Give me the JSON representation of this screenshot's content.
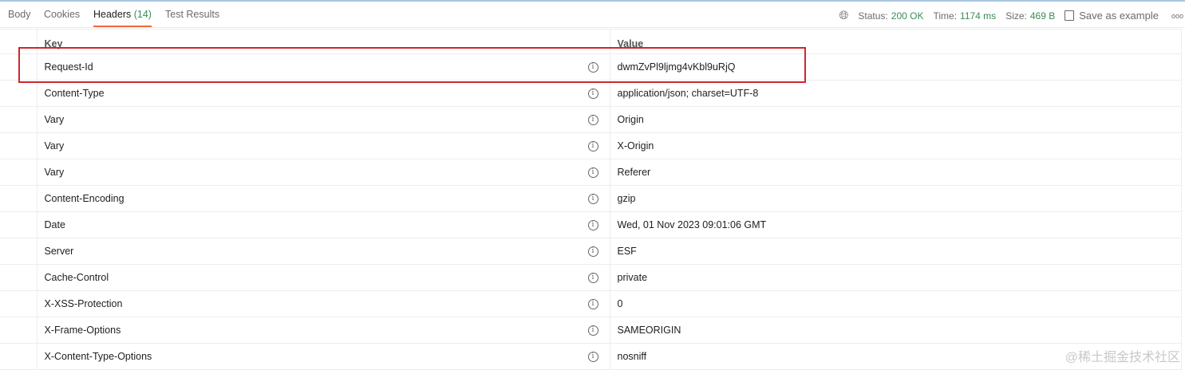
{
  "tabs": [
    {
      "label": "Body"
    },
    {
      "label": "Cookies"
    },
    {
      "label": "Headers",
      "count": "(14)"
    },
    {
      "label": "Test Results"
    }
  ],
  "status": {
    "status_label": "Status:",
    "status_value": "200 OK",
    "time_label": "Time:",
    "time_value": "1174 ms",
    "size_label": "Size:",
    "size_value": "469 B",
    "save_label": "Save as example",
    "more": "ooo"
  },
  "columns": {
    "key": "Key",
    "value": "Value"
  },
  "rows": [
    {
      "key": "Request-Id",
      "value": "dwmZvPl9ljmg4vKbl9uRjQ"
    },
    {
      "key": "Content-Type",
      "value": "application/json; charset=UTF-8"
    },
    {
      "key": "Vary",
      "value": "Origin"
    },
    {
      "key": "Vary",
      "value": "X-Origin"
    },
    {
      "key": "Vary",
      "value": "Referer"
    },
    {
      "key": "Content-Encoding",
      "value": "gzip"
    },
    {
      "key": "Date",
      "value": "Wed, 01 Nov 2023 09:01:06 GMT"
    },
    {
      "key": "Server",
      "value": "ESF"
    },
    {
      "key": "Cache-Control",
      "value": "private"
    },
    {
      "key": "X-XSS-Protection",
      "value": "0"
    },
    {
      "key": "X-Frame-Options",
      "value": "SAMEORIGIN"
    },
    {
      "key": "X-Content-Type-Options",
      "value": "nosniff"
    }
  ],
  "watermark": "@稀土掘金技术社区",
  "colors": {
    "accent": "#f26b3a",
    "success": "#3b8c57",
    "highlight": "#d0262b"
  }
}
